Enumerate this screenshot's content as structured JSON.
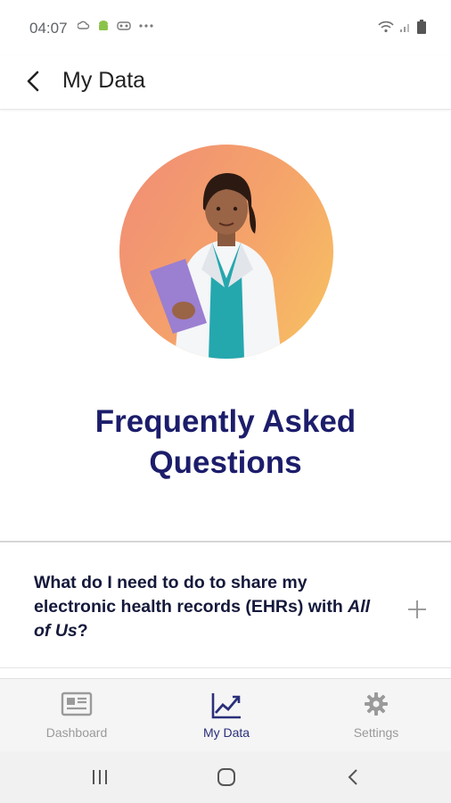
{
  "status_bar": {
    "time": "04:07",
    "left_icons": [
      "cloud-sync-icon",
      "android-icon",
      "vr-icon",
      "more-dots-icon"
    ],
    "right_icons": [
      "wifi-icon",
      "signal-icon",
      "battery-icon"
    ]
  },
  "header": {
    "back_icon": "chevron-left-icon",
    "title": "My Data"
  },
  "hero": {
    "illustration": "doctor-with-clipboard"
  },
  "page": {
    "title_line1": "Frequently Asked",
    "title_line2": "Questions"
  },
  "faq": {
    "items": [
      {
        "question_prefix": "What do I need to do to share my electronic health records (EHRs) with ",
        "question_emphasis": "All of Us",
        "question_suffix": "?",
        "expand_icon": "plus-icon"
      }
    ]
  },
  "tabbar": {
    "tabs": [
      {
        "label": "Dashboard",
        "icon": "newspaper-icon",
        "active": false
      },
      {
        "label": "My Data",
        "icon": "trend-chart-icon",
        "active": true
      },
      {
        "label": "Settings",
        "icon": "gear-icon",
        "active": false
      }
    ]
  },
  "system_nav": {
    "buttons": [
      "recent-apps-icon",
      "home-icon",
      "back-icon"
    ]
  },
  "colors": {
    "title": "#1c1d6b",
    "active_tab": "#2a2f7a",
    "inactive_tab": "#9a9a9a"
  }
}
